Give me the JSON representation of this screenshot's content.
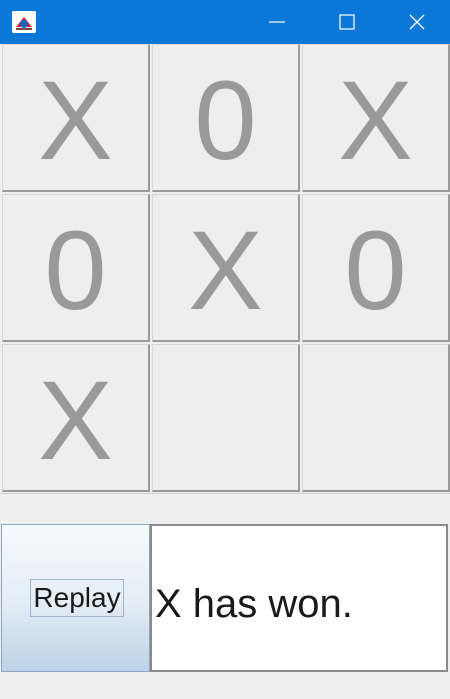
{
  "window": {
    "titlebar_color": "#0b78d7",
    "icons": {
      "app": "java-app-icon",
      "minimize": "minimize-icon",
      "maximize": "maximize-icon",
      "close": "close-icon"
    }
  },
  "board": {
    "cells": [
      "X",
      "0",
      "X",
      "0",
      "X",
      "0",
      "X",
      "",
      ""
    ],
    "mark_color": "#999999"
  },
  "controls": {
    "replay_label": "Replay",
    "status_text": "X has won."
  }
}
